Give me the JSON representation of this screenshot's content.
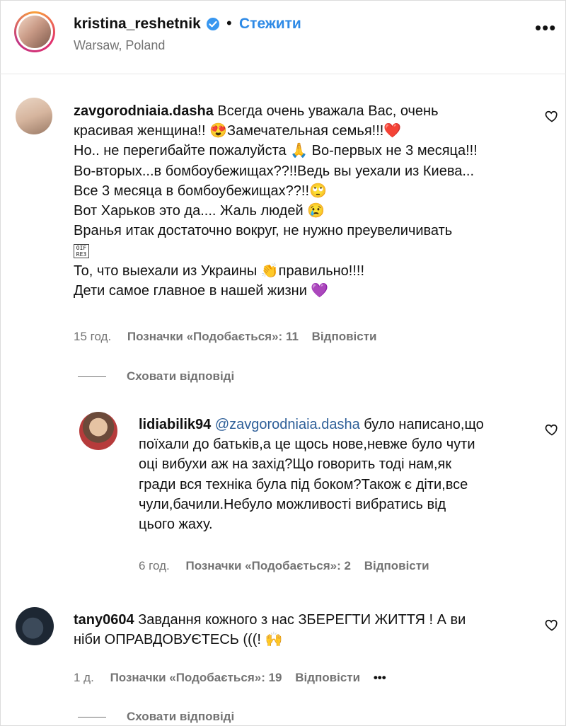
{
  "post_header": {
    "username": "kristina_reshetnik",
    "follow_label": "Стежити",
    "location": "Warsaw, Poland"
  },
  "comments": [
    {
      "username": "zavgorodniaia.dasha",
      "lines": [
        "Всегда очень уважала Вас, очень",
        "красивая женщина!! 😍Замечательная семья!!!❤️",
        "Но.. не перегибайте пожалуйста 🙏 Во-первых не 3 месяца!!!",
        "Во-вторых...в бомбоубежищах??!!Ведь вы уехали из Киева...",
        "Все 3 месяца в бомбоубежищах??!!🙄",
        "Вот Харьков это да.... Жаль людей 😢",
        "Вранья итак достаточно вокруг, не нужно преувеличивать",
        "",
        "То, что выехали из Украины 👏правильно!!!!",
        "Дети самое главное в нашей жизни 💜"
      ],
      "time": "15 год.",
      "likes": "Позначки «Подобається»: 11",
      "reply": "Відповісти",
      "hide_replies": "Сховати відповіді"
    },
    {
      "username": "lidiabilik94",
      "mention": "@zavgorodniaia.dasha",
      "lines": [
        "було написано,що",
        "поїхали до батьків,а це щось нове,невже було чути",
        "оці вибухи аж на захід?Що говорить тоді нам,як",
        "гради вся техніка була під боком?Також є діти,все",
        "чули,бачили.Небуло можливості вибратись від",
        "цього жаху."
      ],
      "time": "6 год.",
      "likes": "Позначки «Подобається»: 2",
      "reply": "Відповісти"
    },
    {
      "username": "tany0604",
      "lines": [
        "Завдання кожного з нас ЗБЕРЕГТИ ЖИТТЯ ! А ви",
        "ніби ОПРАВДОВУЄТЕСЬ (((! 🙌"
      ],
      "time": "1 д.",
      "likes": "Позначки «Подобається»: 19",
      "reply": "Відповісти",
      "more": "•••",
      "hide_replies": "Сховати відповіді"
    }
  ],
  "glyph_box": "OIF\nRE3",
  "colors": {
    "follow": "#2e8ae6",
    "verified": "#3897f0",
    "muted": "#737373"
  }
}
